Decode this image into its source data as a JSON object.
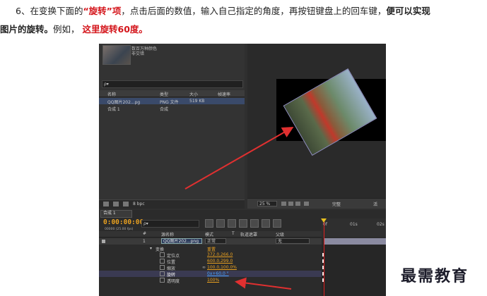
{
  "instruction": {
    "prefix": "6、在变换下面的",
    "highlight_term": "“旋转”项",
    "middle": "，点击后面的数值，输入自己指定的角度，再按钮键盘上的回车键，",
    "bold_end": "便可以实现",
    "line2_bold": "图片的旋转。",
    "example_label": "例如，",
    "example_red": "这里旋转60度。"
  },
  "project_panel": {
    "info_lines": [
      "数百万种颜色",
      "非交错"
    ],
    "search_placeholder": "ρ▾",
    "columns": [
      "名称",
      "类型",
      "大小",
      "帧速率"
    ],
    "items": [
      {
        "name": "QQ图片202...pg",
        "type": "PNG 文件",
        "size": "519 KB"
      },
      {
        "name": "合成 1",
        "type": "合成",
        "size": ""
      }
    ],
    "footer_bpc": "8 bpc"
  },
  "comp_viewer": {
    "zoom": "25 %",
    "view_label": "完整",
    "view_label2": "活"
  },
  "timeline": {
    "tab_label": "合成 1",
    "timecode": "0:00:00:00",
    "fps": "00000 (25.00 fps)",
    "search_placeholder": "ρ▾",
    "columns": [
      "#",
      "源名称",
      "模式",
      "T",
      "轨道遮罩",
      "父级"
    ],
    "ruler_labels": [
      "0f",
      "01s",
      "02s"
    ],
    "layer": {
      "index": "1",
      "source": "QQ图片202...png",
      "mode": "正常",
      "parent": "无"
    },
    "transform_group": "变换",
    "transform_reset": "重置",
    "properties": [
      {
        "name": "定位点",
        "value": "372.0,266.0"
      },
      {
        "name": "位置",
        "value": "600.0,299.0"
      },
      {
        "name": "缩放",
        "value": "100.0,100.0%"
      },
      {
        "name": "旋转",
        "value": "0x+60.0 °"
      },
      {
        "name": "透明度",
        "value": "100%"
      }
    ]
  },
  "watermark": "最需教育"
}
